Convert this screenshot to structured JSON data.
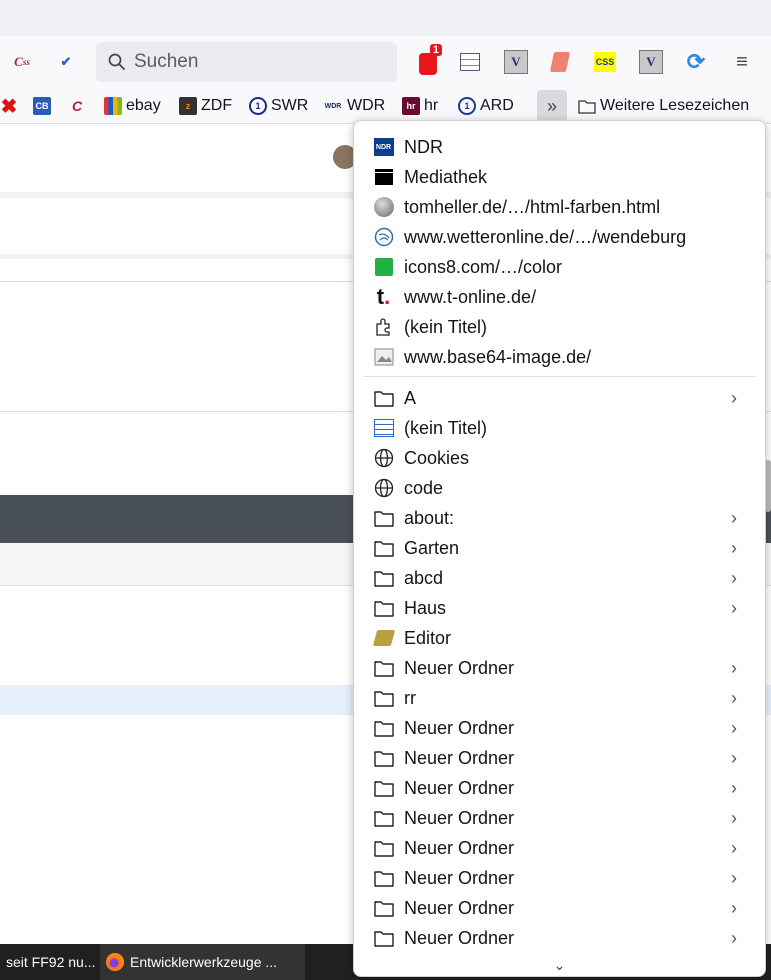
{
  "toolbar": {
    "search_placeholder": "Suchen",
    "notification_badge": "1",
    "icons": [
      "css-validator-icon",
      "w3c-validator-icon",
      "notification-icon",
      "table-check-icon",
      "v-validator-icon",
      "scroll-icon",
      "css-icon",
      "v-validator-icon-2",
      "sync-icon",
      "menu-icon"
    ],
    "css_label": "CSS",
    "v_label": "V"
  },
  "bookmarks": {
    "items": [
      {
        "label": "",
        "icon": "x-icon"
      },
      {
        "label": "",
        "icon": "cb-icon"
      },
      {
        "label": "",
        "icon": "css-icon"
      },
      {
        "label": "ebay",
        "icon": "shopping-bag-icon"
      },
      {
        "label": "ZDF",
        "icon": "zdf-icon"
      },
      {
        "label": "SWR",
        "icon": "swr-icon"
      },
      {
        "label": "WDR",
        "icon": "wdr-icon"
      },
      {
        "label": "hr",
        "icon": "hr-icon"
      },
      {
        "label": "ARD",
        "icon": "ard-icon"
      }
    ],
    "more_label": "Weitere Lesezeichen"
  },
  "menu": {
    "top_items": [
      {
        "label": "NDR",
        "icon": "ndr-icon"
      },
      {
        "label": "Mediathek",
        "icon": "clapperboard-icon"
      },
      {
        "label": "tomheller.de/…/html-farben.html",
        "icon": "sphere-icon"
      },
      {
        "label": "www.wetteronline.de/…/wendeburg",
        "icon": "weather-icon"
      },
      {
        "label": "icons8.com/…/color",
        "icon": "icons8-icon"
      },
      {
        "label": "www.t-online.de/",
        "icon": "t-online-icon"
      },
      {
        "label": "(kein Titel)",
        "icon": "puzzle-icon"
      },
      {
        "label": "www.base64-image.de/",
        "icon": "image-icon"
      }
    ],
    "items": [
      {
        "label": "A",
        "icon": "folder",
        "sub": true
      },
      {
        "label": "(kein Titel)",
        "icon": "table",
        "sub": false
      },
      {
        "label": "Cookies",
        "icon": "globe",
        "sub": false
      },
      {
        "label": "code",
        "icon": "globe",
        "sub": false
      },
      {
        "label": "about:",
        "icon": "folder",
        "sub": true
      },
      {
        "label": "Garten",
        "icon": "folder",
        "sub": true
      },
      {
        "label": "abcd",
        "icon": "folder",
        "sub": true
      },
      {
        "label": "Haus",
        "icon": "folder",
        "sub": true
      },
      {
        "label": "Editor",
        "icon": "notepad",
        "sub": false
      },
      {
        "label": "Neuer Ordner",
        "icon": "folder",
        "sub": true
      },
      {
        "label": "rr",
        "icon": "folder",
        "sub": true
      },
      {
        "label": "Neuer Ordner",
        "icon": "folder",
        "sub": true
      },
      {
        "label": "Neuer Ordner",
        "icon": "folder",
        "sub": true
      },
      {
        "label": "Neuer Ordner",
        "icon": "folder",
        "sub": true
      },
      {
        "label": "Neuer Ordner",
        "icon": "folder",
        "sub": true
      },
      {
        "label": "Neuer Ordner",
        "icon": "folder",
        "sub": true
      },
      {
        "label": "Neuer Ordner",
        "icon": "folder",
        "sub": true
      },
      {
        "label": "Neuer Ordner",
        "icon": "folder",
        "sub": true
      },
      {
        "label": "Neuer Ordner",
        "icon": "folder",
        "sub": true
      }
    ]
  },
  "taskbar": {
    "items": [
      {
        "label": "seit FF92 nu..."
      },
      {
        "label": "Entwicklerwerkzeuge ..."
      }
    ]
  }
}
